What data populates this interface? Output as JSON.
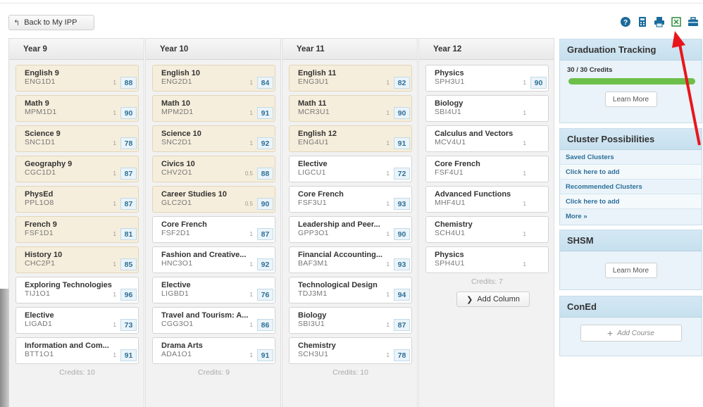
{
  "toolbar": {
    "back_label": "Back to My IPP",
    "icons": [
      "help-icon",
      "calculator-icon",
      "print-icon",
      "export-icon",
      "toolbox-icon"
    ]
  },
  "colors": {
    "completed_card": "#f6eedc",
    "grade_badge": "#eaf4fa",
    "accent_link": "#2d6e99",
    "progress": "#6cc04a",
    "annotation_arrow": "#e8161b"
  },
  "columns": [
    {
      "title": "Year 9",
      "credits": "Credits: 10",
      "courses": [
        {
          "name": "English 9",
          "code": "ENG1D1",
          "credit": "1",
          "grade": "88",
          "done": true
        },
        {
          "name": "Math 9",
          "code": "MPM1D1",
          "credit": "1",
          "grade": "90",
          "done": true
        },
        {
          "name": "Science 9",
          "code": "SNC1D1",
          "credit": "1",
          "grade": "78",
          "done": true
        },
        {
          "name": "Geography 9",
          "code": "CGC1D1",
          "credit": "1",
          "grade": "87",
          "done": true
        },
        {
          "name": "PhysEd",
          "code": "PPL1O8",
          "credit": "1",
          "grade": "87",
          "done": true
        },
        {
          "name": "French 9",
          "code": "FSF1D1",
          "credit": "1",
          "grade": "81",
          "done": true
        },
        {
          "name": "History 10",
          "code": "CHC2P1",
          "credit": "1",
          "grade": "85",
          "done": true
        },
        {
          "name": "Exploring Technologies",
          "code": "TIJ1O1",
          "credit": "1",
          "grade": "96",
          "done": false
        },
        {
          "name": "Elective",
          "code": "LIGAD1",
          "credit": "1",
          "grade": "73",
          "done": false
        },
        {
          "name": "Information and Com...",
          "code": "BTT1O1",
          "credit": "1",
          "grade": "91",
          "done": false
        }
      ]
    },
    {
      "title": "Year 10",
      "credits": "Credits: 9",
      "courses": [
        {
          "name": "English 10",
          "code": "ENG2D1",
          "credit": "1",
          "grade": "84",
          "done": true
        },
        {
          "name": "Math 10",
          "code": "MPM2D1",
          "credit": "1",
          "grade": "91",
          "done": true
        },
        {
          "name": "Science 10",
          "code": "SNC2D1",
          "credit": "1",
          "grade": "92",
          "done": true
        },
        {
          "name": "Civics 10",
          "code": "CHV2O1",
          "credit": "0.5",
          "grade": "88",
          "done": true
        },
        {
          "name": "Career Studies 10",
          "code": "GLC2O1",
          "credit": "0.5",
          "grade": "90",
          "done": true
        },
        {
          "name": "Core French",
          "code": "FSF2D1",
          "credit": "1",
          "grade": "87",
          "done": false
        },
        {
          "name": "Fashion and Creative...",
          "code": "HNC3O1",
          "credit": "1",
          "grade": "92",
          "done": false
        },
        {
          "name": "Elective",
          "code": "LIGBD1",
          "credit": "1",
          "grade": "76",
          "done": false
        },
        {
          "name": "Travel and Tourism: A...",
          "code": "CGG3O1",
          "credit": "1",
          "grade": "86",
          "done": false
        },
        {
          "name": "Drama Arts",
          "code": "ADA1O1",
          "credit": "1",
          "grade": "91",
          "done": false
        }
      ]
    },
    {
      "title": "Year 11",
      "credits": "Credits: 10",
      "courses": [
        {
          "name": "English 11",
          "code": "ENG3U1",
          "credit": "1",
          "grade": "82",
          "done": true
        },
        {
          "name": "Math 11",
          "code": "MCR3U1",
          "credit": "1",
          "grade": "90",
          "done": true
        },
        {
          "name": "English 12",
          "code": "ENG4U1",
          "credit": "1",
          "grade": "91",
          "done": true
        },
        {
          "name": "Elective",
          "code": "LIGCU1",
          "credit": "1",
          "grade": "72",
          "done": false
        },
        {
          "name": "Core French",
          "code": "FSF3U1",
          "credit": "1",
          "grade": "93",
          "done": false
        },
        {
          "name": "Leadership and Peer...",
          "code": "GPP3O1",
          "credit": "1",
          "grade": "90",
          "done": false
        },
        {
          "name": "Financial Accounting...",
          "code": "BAF3M1",
          "credit": "1",
          "grade": "93",
          "done": false
        },
        {
          "name": "Technological Design",
          "code": "TDJ3M1",
          "credit": "1",
          "grade": "94",
          "done": false
        },
        {
          "name": "Biology",
          "code": "SBI3U1",
          "credit": "1",
          "grade": "87",
          "done": false
        },
        {
          "name": "Chemistry",
          "code": "SCH3U1",
          "credit": "1",
          "grade": "78",
          "done": false
        }
      ]
    },
    {
      "title": "Year 12",
      "credits": "Credits: 7",
      "add_column": "Add Column",
      "courses": [
        {
          "name": "Physics",
          "code": "SPH3U1",
          "credit": "1",
          "grade": "90",
          "done": false
        },
        {
          "name": "Biology",
          "code": "SBI4U1",
          "credit": "1",
          "grade": "",
          "done": false
        },
        {
          "name": "Calculus and Vectors",
          "code": "MCV4U1",
          "credit": "1",
          "grade": "",
          "done": false
        },
        {
          "name": "Core French",
          "code": "FSF4U1",
          "credit": "1",
          "grade": "",
          "done": false
        },
        {
          "name": "Advanced Functions",
          "code": "MHF4U1",
          "credit": "1",
          "grade": "",
          "done": false
        },
        {
          "name": "Chemistry",
          "code": "SCH4U1",
          "credit": "1",
          "grade": "",
          "done": false
        },
        {
          "name": "Physics",
          "code": "SPH4U1",
          "credit": "1",
          "grade": "",
          "done": false
        }
      ]
    }
  ],
  "sidebar": {
    "graduation": {
      "title": "Graduation Tracking",
      "credits": "30 / 30 Credits",
      "progress": 1.0,
      "learn_more": "Learn More"
    },
    "clusters": {
      "title": "Cluster Possibilities",
      "saved": "Saved Clusters",
      "saved_add": "Click here to add",
      "recommended": "Recommended Clusters",
      "recommended_add": "Click here to add",
      "more": "More »"
    },
    "shsm": {
      "title": "SHSM",
      "learn_more": "Learn More"
    },
    "coned": {
      "title": "ConEd",
      "add_course": "Add Course"
    }
  }
}
